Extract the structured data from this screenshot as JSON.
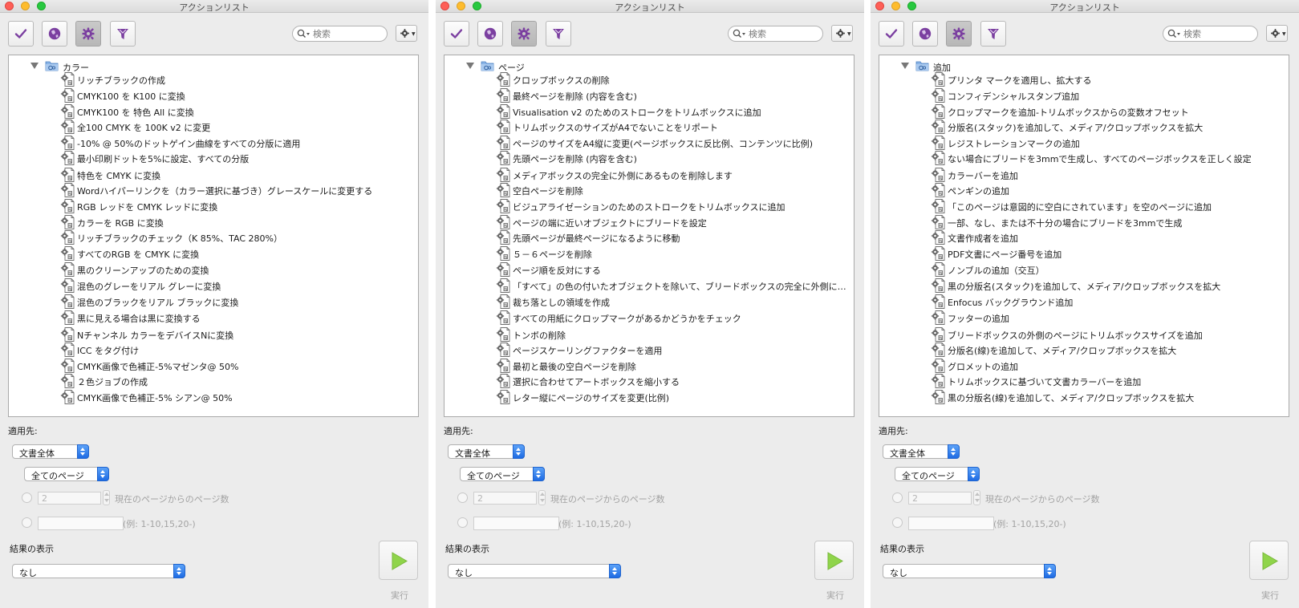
{
  "panels": [
    {
      "window_title": "アクションリスト",
      "search_placeholder": "検索",
      "tree_root": "カラー",
      "items": [
        "リッチブラックの作成",
        "CMYK100 を K100 に変換",
        "CMYK100 を 特色 All に変換",
        "全100 CMYK を 100K v2 に変更",
        "-10% @ 50%のドットゲイン曲線をすべての分版に適用",
        "最小印刷ドットを5%に設定、すべての分版",
        "特色を CMYK に変換",
        "Wordハイパーリンクを（カラー選択に基づき）グレースケールに変更する",
        "RGB レッドを CMYK レッドに変換",
        "カラーを RGB に変換",
        "リッチブラックのチェック（K 85%、TAC 280%）",
        "すべてのRGB を CMYK に変換",
        "黒のクリーンアップのための変換",
        "混色のグレーをリアル グレーに変換",
        "混色のブラックをリアル ブラックに変換",
        "黒に見える場合は黒に変換する",
        "Nチャンネル カラーをデバイスNに変換",
        "ICC をタグ付け",
        "CMYK画像で色補正-5%マゼンタ@ 50%",
        "２色ジョブの作成",
        "CMYK画像で色補正-5% シアン@ 50%"
      ],
      "apply_to_label": "適用先:",
      "apply_select": "文書全体",
      "pages_select": "全てのページ",
      "page_count_value": "2",
      "page_count_label": "現在のページからのページ数",
      "range_hint": "(例: 1-10,15,20-)",
      "results_label": "結果の表示",
      "results_select": "なし",
      "run_label": "実行"
    },
    {
      "window_title": "アクションリスト",
      "search_placeholder": "検索",
      "tree_root": "ページ",
      "items": [
        "クロップボックスの削除",
        "最終ページを削除 (内容を含む)",
        "Visualisation v2 のためのストロークをトリムボックスに追加",
        "トリムボックスのサイズがA4でないことをリポート",
        "ページのサイズをA4縦に変更(ページボックスに反比例、コンテンツに比例)",
        "先頭ページを削除 (内容を含む)",
        "メディアボックスの完全に外側にあるものを削除します",
        "空白ページを削除",
        "ビジュアライゼーションのためのストロークをトリムボックスに追加",
        "ページの端に近いオブジェクトにブリードを設定",
        "先頭ページが最終ページになるように移動",
        "５－６ページを削除",
        "ページ順を反対にする",
        "「すべて」の色の付いたオブジェクトを除いて、ブリードボックスの完全に外側にあるものを削除",
        "裁ち落としの領域を作成",
        "すべての用紙にクロップマークがあるかどうかをチェック",
        "トンボの削除",
        "ページスケーリングファクターを適用",
        "最初と最後の空白ページを削除",
        "選択に合わせてアートボックスを縮小する",
        "レター縦にページのサイズを変更(比例)"
      ],
      "apply_to_label": "適用先:",
      "apply_select": "文書全体",
      "pages_select": "全てのページ",
      "page_count_value": "2",
      "page_count_label": "現在のページからのページ数",
      "range_hint": "(例: 1-10,15,20-)",
      "results_label": "結果の表示",
      "results_select": "なし",
      "run_label": "実行"
    },
    {
      "window_title": "アクションリスト",
      "search_placeholder": "検索",
      "tree_root": "追加",
      "items": [
        "プリンタ マークを適用し、拡大する",
        "コンフィデンシャルスタンプ追加",
        "クロップマークを追加-トリムボックスからの変数オフセット",
        "分版名(スタック)を追加して、メディア/クロップボックスを拡大",
        "レジストレーションマークの追加",
        "ない場合にブリードを3mmで生成し、すべてのページボックスを正しく設定",
        "カラーバーを追加",
        "ペンギンの追加",
        "「このページは意図的に空白にされています」を空のページに追加",
        "一部、なし、または不十分の場合にブリードを3mmで生成",
        "文書作成者を追加",
        "PDF文書にページ番号を追加",
        "ノンブルの追加（交互）",
        "黒の分版名(スタック)を追加して、メディア/クロップボックスを拡大",
        "Enfocus バックグラウンド追加",
        "フッターの追加",
        "ブリードボックスの外側のページにトリムボックスサイズを追加",
        "分版名(線)を追加して、メディア/クロップボックスを拡大",
        "グロメットの追加",
        "トリムボックスに基づいて文書カラーバーを追加",
        "黒の分版名(線)を追加して、メディア/クロップボックスを拡大"
      ],
      "apply_to_label": "適用先:",
      "apply_select": "文書全体",
      "pages_select": "全てのページ",
      "page_count_value": "2",
      "page_count_label": "現在のページからのページ数",
      "range_hint": "(例: 1-10,15,20-)",
      "results_label": "結果の表示",
      "results_select": "なし",
      "run_label": "実行"
    }
  ],
  "toolbar_icons": [
    "checkmark-icon",
    "globe-icon",
    "gear-icon",
    "funnel-icon"
  ],
  "colors": {
    "toolbar_icon_purple": "#7b3fa0",
    "select_accent_blue": "#2a74ea",
    "run_arrow_green": "#8fd44a",
    "panel_background": "#ececec"
  }
}
